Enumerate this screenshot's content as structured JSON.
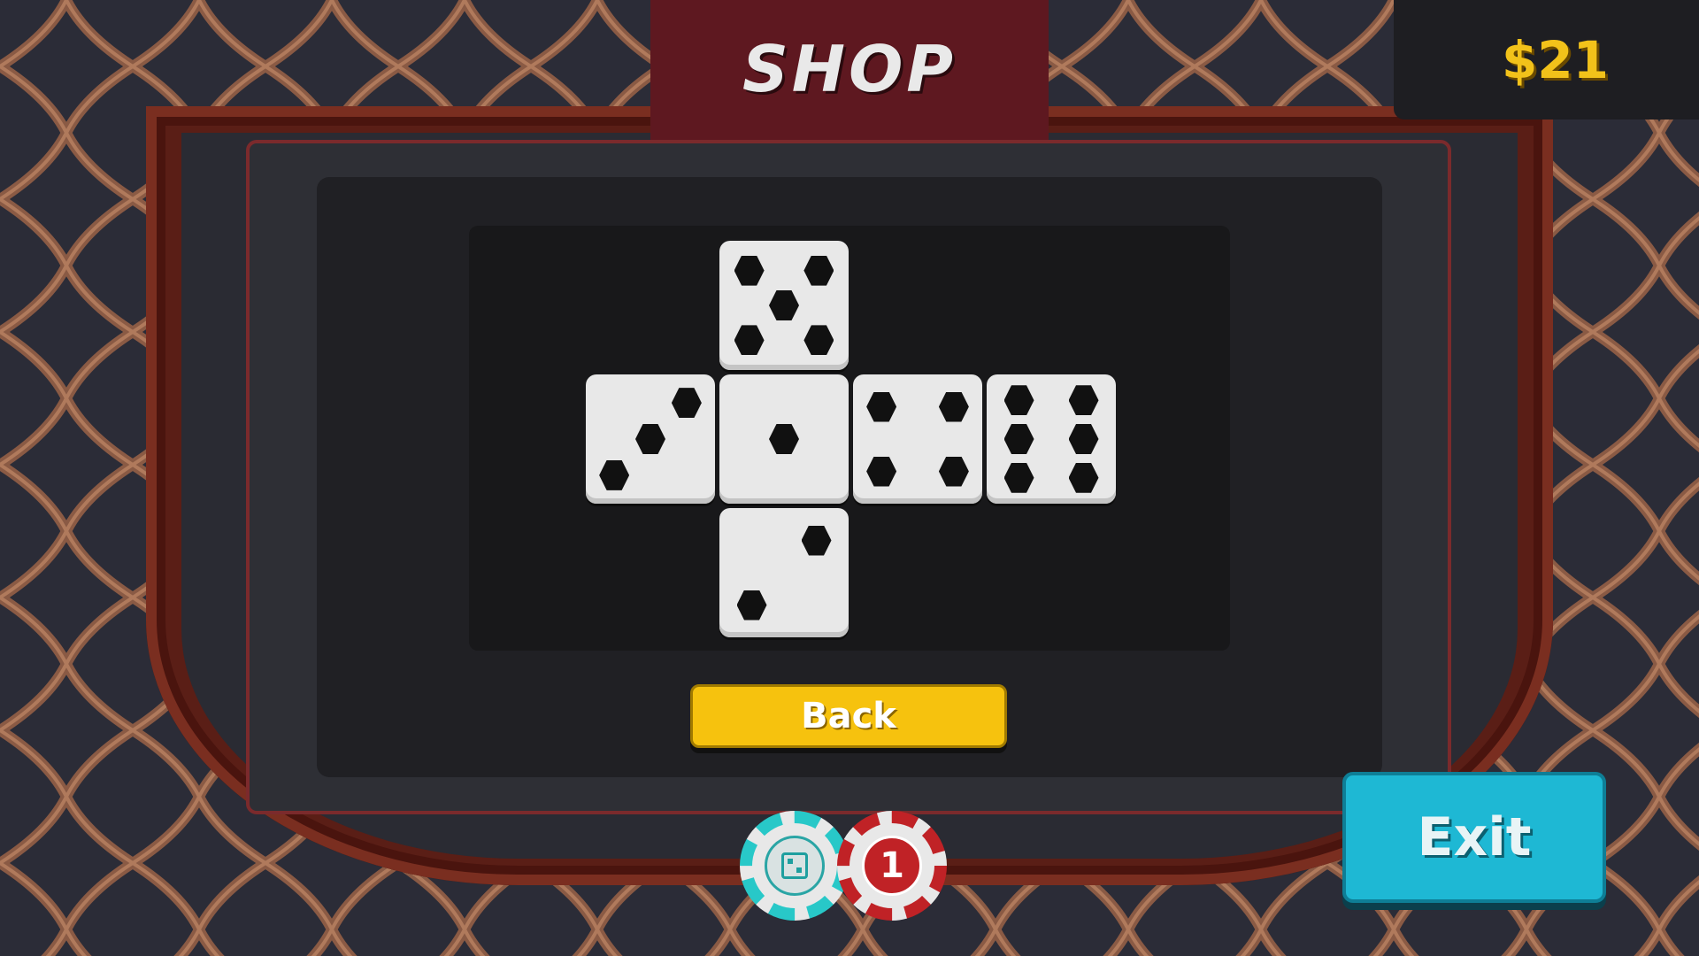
{
  "header": {
    "title": "SHOP"
  },
  "wallet": {
    "money": "$21"
  },
  "dice_net": {
    "faces": [
      {
        "id": "top",
        "value": 5
      },
      {
        "id": "left",
        "value": 3
      },
      {
        "id": "center",
        "value": 1
      },
      {
        "id": "right",
        "value": 4
      },
      {
        "id": "far-right",
        "value": 6
      },
      {
        "id": "bottom",
        "value": 2
      }
    ],
    "die_color": "#e8e8e8",
    "pip_color": "#111111"
  },
  "buttons": {
    "back_label": "Back",
    "exit_label": "Exit"
  },
  "chips": {
    "red_value": "1",
    "teal_icon": "dice-icon"
  },
  "colors": {
    "back_button": "#f6c20e",
    "exit_button": "#1eb8d4",
    "money": "#f2c21a",
    "shop_tab": "#5e1820"
  }
}
